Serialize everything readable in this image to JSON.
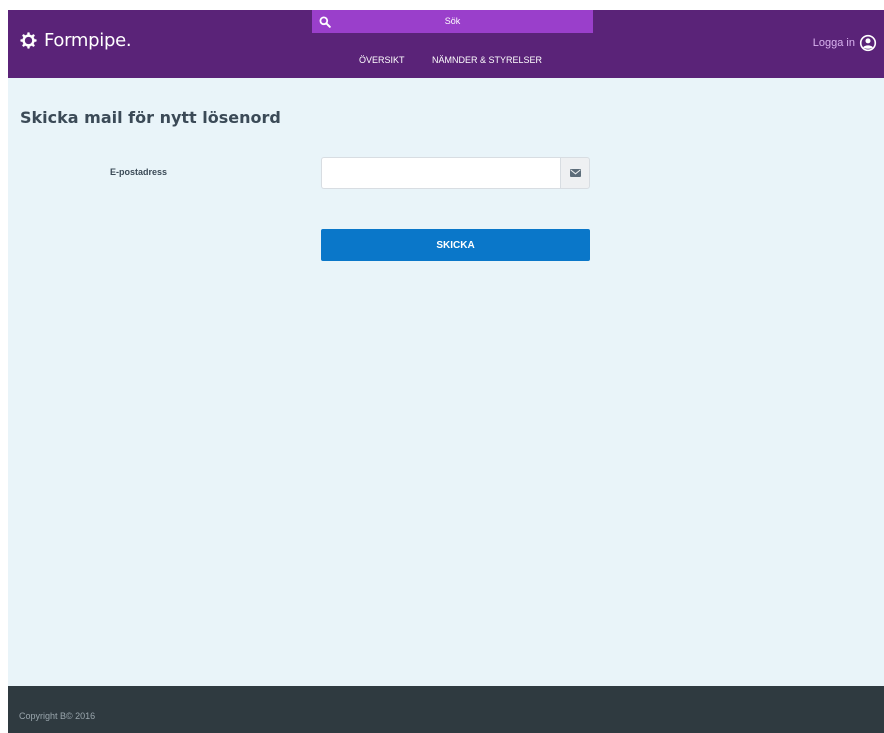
{
  "header": {
    "logo_text": "Formpipe.",
    "search_placeholder": "Sök",
    "nav": [
      {
        "label": "ÖVERSIKT"
      },
      {
        "label": "NÄMNDER & STYRELSER"
      }
    ],
    "login_label": "Logga in"
  },
  "main": {
    "title": "Skicka mail för nytt lösenord",
    "email_label": "E-postadress",
    "email_value": "",
    "submit_label": "SKICKA"
  },
  "footer": {
    "copyright": "Copyright B© 2016"
  },
  "colors": {
    "header_bg": "#5a2378",
    "search_bg": "#9a3fcb",
    "page_bg": "#e9f4f9",
    "button_bg": "#0a77c9",
    "footer_bg": "#2f3a40"
  },
  "icons": {
    "logo": "gear-logo-icon",
    "search": "search-icon",
    "user": "user-circle-icon",
    "email": "envelope-icon"
  }
}
